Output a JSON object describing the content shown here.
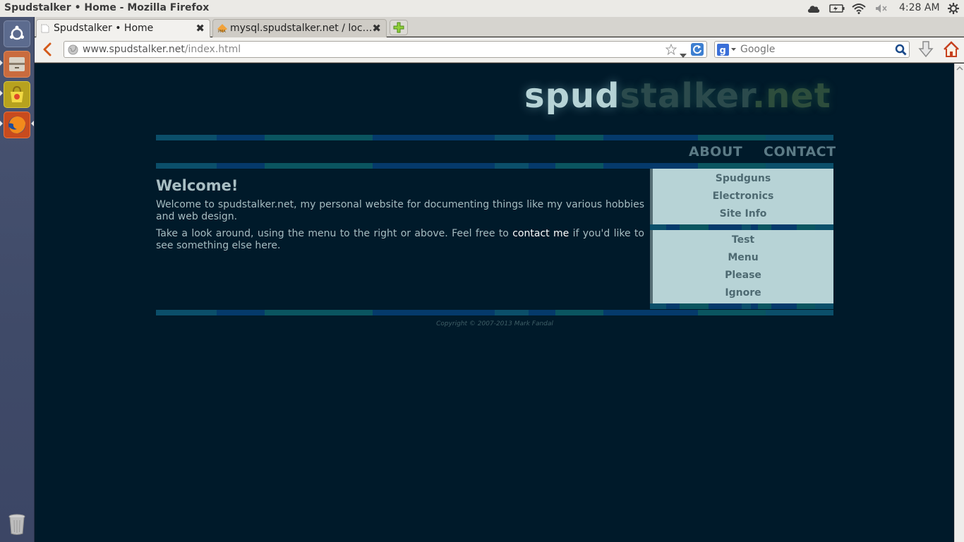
{
  "window": {
    "title": "Spudstalker • Home - Mozilla Firefox"
  },
  "top_panel": {
    "clock": "4:28 AM"
  },
  "tabs": [
    {
      "label": "Spudstalker • Home",
      "active": true
    },
    {
      "label": "mysql.spudstalker.net / loc…",
      "active": false
    }
  ],
  "navbar": {
    "url_host": "www.spudstalker.net",
    "url_path": "/index.html",
    "search_placeholder": "Google"
  },
  "site": {
    "logo_part1": "spud",
    "logo_part2": "stalker",
    "logo_part3": ".net",
    "topnav": [
      "ABOUT",
      "CONTACT"
    ],
    "welcome_heading": "Welcome!",
    "para1": "Welcome to spudstalker.net, my personal website for documenting things like my various hobbies and web design.",
    "para2_before": "Take a look around, using the menu to the right or above. Feel free to ",
    "para2_link": "contact me",
    "para2_after": " if you'd like to see something else here.",
    "sidebar_group1": [
      "Spudguns",
      "Electronics",
      "Site Info"
    ],
    "sidebar_group2": [
      "Test",
      "Menu",
      "Please",
      "Ignore"
    ],
    "copyright": "Copyright © 2007-2013 Mark Fandal"
  },
  "colors": {
    "page_bg": "#001a2a",
    "sidebar_bg": "#b7d3d6",
    "nav_text": "#5c7b86",
    "stripe_a": "#0b4f6a",
    "stripe_b": "#053a6b",
    "stripe_c": "#0a5560"
  }
}
